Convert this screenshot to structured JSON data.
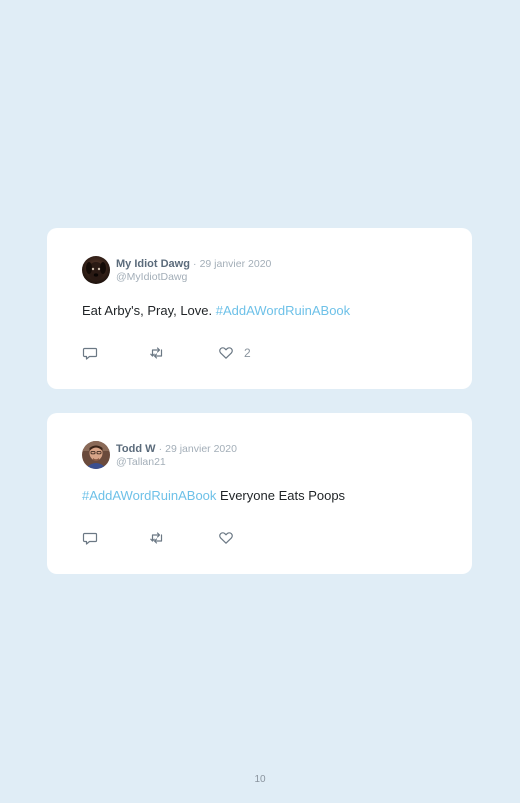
{
  "tweets": [
    {
      "display_name": "My Idiot Dawg",
      "separator": "·",
      "date": "29 janvier 2020",
      "handle": "@MyIdiotDawg",
      "text_before": "Eat Arby's, Pray, Love. ",
      "hashtag": "#AddAWordRuinABook",
      "text_after": "",
      "like_count": "2",
      "avatar_icon": "dog-avatar"
    },
    {
      "display_name": "Todd W",
      "separator": "·",
      "date": "29 janvier 2020",
      "handle": "@Tallan21",
      "text_before": "",
      "hashtag": "#AddAWordRuinABook",
      "text_after": " Everyone Eats Poops",
      "like_count": "",
      "avatar_icon": "person-avatar"
    }
  ],
  "page": {
    "number": "10"
  },
  "colors": {
    "background": "#e0edf6",
    "card": "#ffffff",
    "hashtag": "#6ec1e8",
    "muted": "#a3aeb8"
  }
}
